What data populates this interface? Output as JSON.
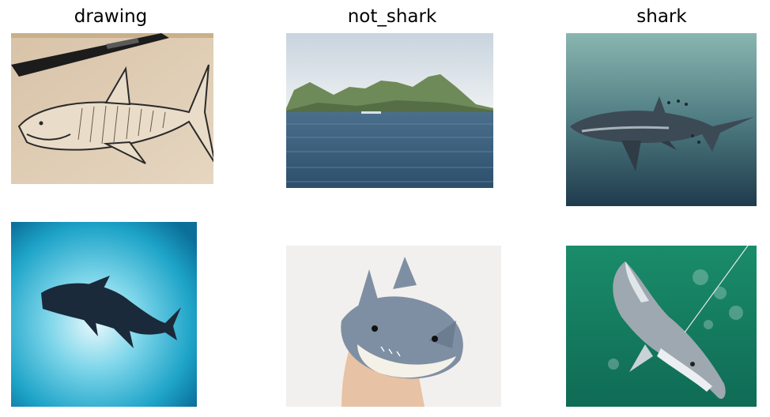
{
  "columns": [
    {
      "title": "drawing"
    },
    {
      "title": "not_shark"
    },
    {
      "title": "shark"
    }
  ],
  "images": [
    {
      "column": "drawing",
      "subject": "pencil-sketch-shark"
    },
    {
      "column": "drawing",
      "subject": "shark-silhouette-watercolor"
    },
    {
      "column": "not_shark",
      "subject": "ocean-island-landscape"
    },
    {
      "column": "not_shark",
      "subject": "crochet-shark-toy"
    },
    {
      "column": "shark",
      "subject": "thresher-shark-underwater"
    },
    {
      "column": "shark",
      "subject": "hooked-shark-surface"
    }
  ]
}
